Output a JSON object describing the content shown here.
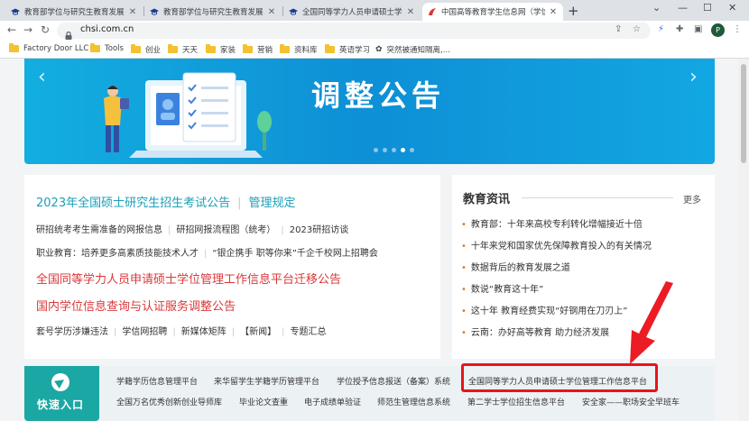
{
  "tabs": [
    {
      "title": "教育部学位与研究生教育发展中心",
      "active": false
    },
    {
      "title": "教育部学位与研究生教育发展中心",
      "active": false
    },
    {
      "title": "全国同等学力人员申请硕士学位管",
      "active": false
    },
    {
      "title": "中国高等教育学生信息网（学信网）",
      "active": true
    }
  ],
  "window": {
    "minimize": "⌄",
    "restore": "—",
    "maximize": "☐",
    "close": "✕",
    "new_tab": "+"
  },
  "nav": {
    "back": "←",
    "forward": "→",
    "reload": "↻"
  },
  "omnibox": {
    "url": "chsi.com.cn"
  },
  "profile": {
    "initial": "P"
  },
  "bookmarks": [
    "Factory Door LLC",
    "Tools",
    "创业",
    "天天",
    "家装",
    "营销",
    "资料库",
    "英语学习",
    "突然被通知隔离,..."
  ],
  "banner": {
    "title": "调整公告",
    "prev": "‹",
    "next": "›",
    "dots": 5,
    "active_dot": 3
  },
  "headline": {
    "main": "2023年全国硕士研究生招生考试公告",
    "secondary": "管理规定"
  },
  "rows": [
    [
      "研招统考考生需准备的网报信息",
      "研招网报流程图（统考）",
      "2023研招访谈"
    ],
    [
      "职业教育：培养更多高素质技能技术人才",
      "“银企携手 职等你来”千企千校网上招聘会"
    ]
  ],
  "red_links": [
    "全国同等学力人员申请硕士学位管理工作信息平台迁移公告",
    "国内学位信息查询与认证服务调整公告"
  ],
  "bottom_row": [
    "套号学历涉嫌违法",
    "学信网招聘",
    "新媒体矩阵",
    "【新闻】",
    "专题汇总"
  ],
  "news": {
    "title": "教育资讯",
    "more": "更多",
    "items": [
      "教育部：十年来高校专利转化增幅接近十倍",
      "十年来党和国家优先保障教育投入的有关情况",
      "数据背后的教育发展之道",
      "数说“教育这十年”",
      "这十年 教育经费实现“好钢用在刀刃上”",
      "云南：办好高等教育 助力经济发展"
    ]
  },
  "quick": {
    "label": "快速入口",
    "row1": [
      "学籍学历信息管理平台",
      "来华留学生学籍学历管理平台",
      "学位授予信息报送（备案）系统",
      "全国同等学力人员申请硕士学位管理工作信息平台"
    ],
    "row2": [
      "全国万名优秀创新创业导师库",
      "毕业论文查重",
      "电子成绩单验证",
      "师范生管理信息系统",
      "第二学士学位招生信息平台",
      "安全家——职场安全早班车"
    ]
  },
  "colors": {
    "teal": "#1a9fb8",
    "red": "#d9383a",
    "highlight": "#e8141c",
    "banner": "#0e8fd6",
    "quick_badge": "#1ba7a4"
  }
}
